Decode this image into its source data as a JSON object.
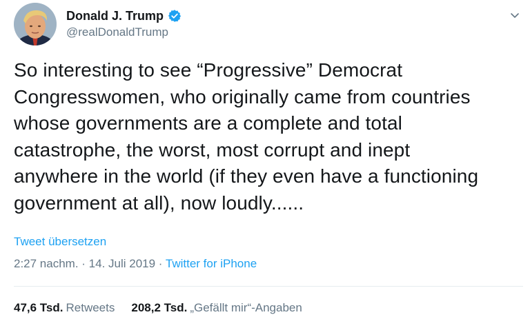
{
  "author": {
    "display_name": "Donald J. Trump",
    "handle": "@realDonaldTrump",
    "verified": true
  },
  "tweet": {
    "lines": [
      "So interesting to see “Progressive” Democrat",
      "Congresswomen, who originally came from countries",
      "whose governments are a complete and total",
      "catastrophe, the worst, most corrupt and inept",
      "anywhere in the world (if they even have a functioning",
      "government at all), now loudly......"
    ]
  },
  "translate_label": "Tweet übersetzen",
  "meta": {
    "time": "2:27 nachm.",
    "separator1": " · ",
    "date": "14. Juli 2019",
    "separator2": " · ",
    "source": "Twitter for iPhone"
  },
  "stats": {
    "retweets_count": "47,6 Tsd.",
    "retweets_label": "Retweets",
    "likes_count": "208,2 Tsd.",
    "likes_label": "„Gefällt mir“-Angaben"
  },
  "colors": {
    "link": "#1da1f2",
    "secondary_text": "#657786",
    "primary_text": "#14171a",
    "verified_badge": "#1da1f2"
  },
  "icons": {
    "verified": "verified-badge-icon",
    "menu": "chevron-down-icon"
  }
}
